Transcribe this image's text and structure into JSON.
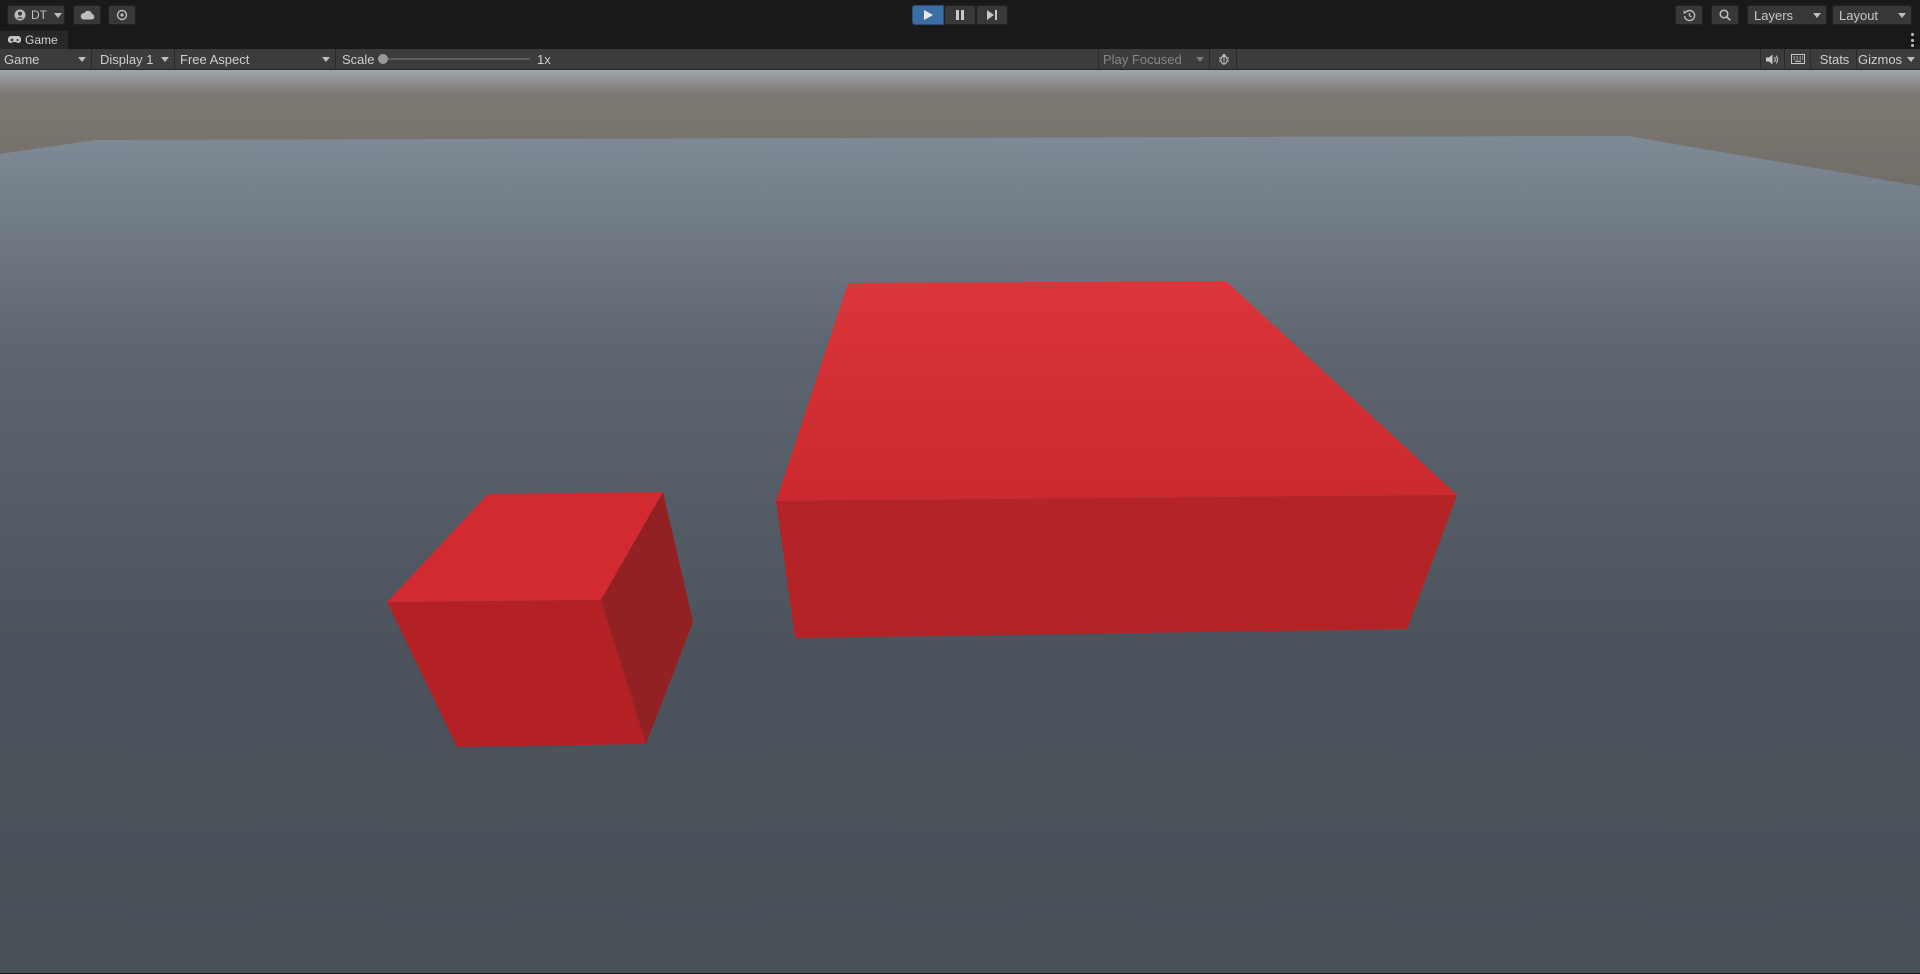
{
  "toolbar": {
    "account_label": "DT",
    "layers_label": "Layers",
    "layout_label": "Layout"
  },
  "tab": {
    "title": "Game"
  },
  "game_bar": {
    "view_mode": "Game",
    "display": "Display 1",
    "aspect": "Free Aspect",
    "scale_label": "Scale",
    "scale_value": "1x",
    "play_mode": "Play Focused",
    "stats_label": "Stats",
    "gizmos_label": "Gizmos"
  },
  "colors": {
    "play_active": "#3a6ea5",
    "cube_top": "#d12e33",
    "cube_front": "#b52224",
    "cube_side": "#952224",
    "ground": "#4b525b",
    "horizon": "#6d6560"
  },
  "icons": {
    "account": "account-icon",
    "cloud": "cloud-icon",
    "collab": "collab-icon",
    "play": "play-icon",
    "pause": "pause-icon",
    "step": "step-icon",
    "history": "history-icon",
    "search": "search-icon",
    "gamepad": "gamepad-icon",
    "bug": "bug-icon",
    "mute": "audio-icon",
    "keyboard": "keyboard-icon",
    "kebab": "kebab-menu-icon"
  }
}
